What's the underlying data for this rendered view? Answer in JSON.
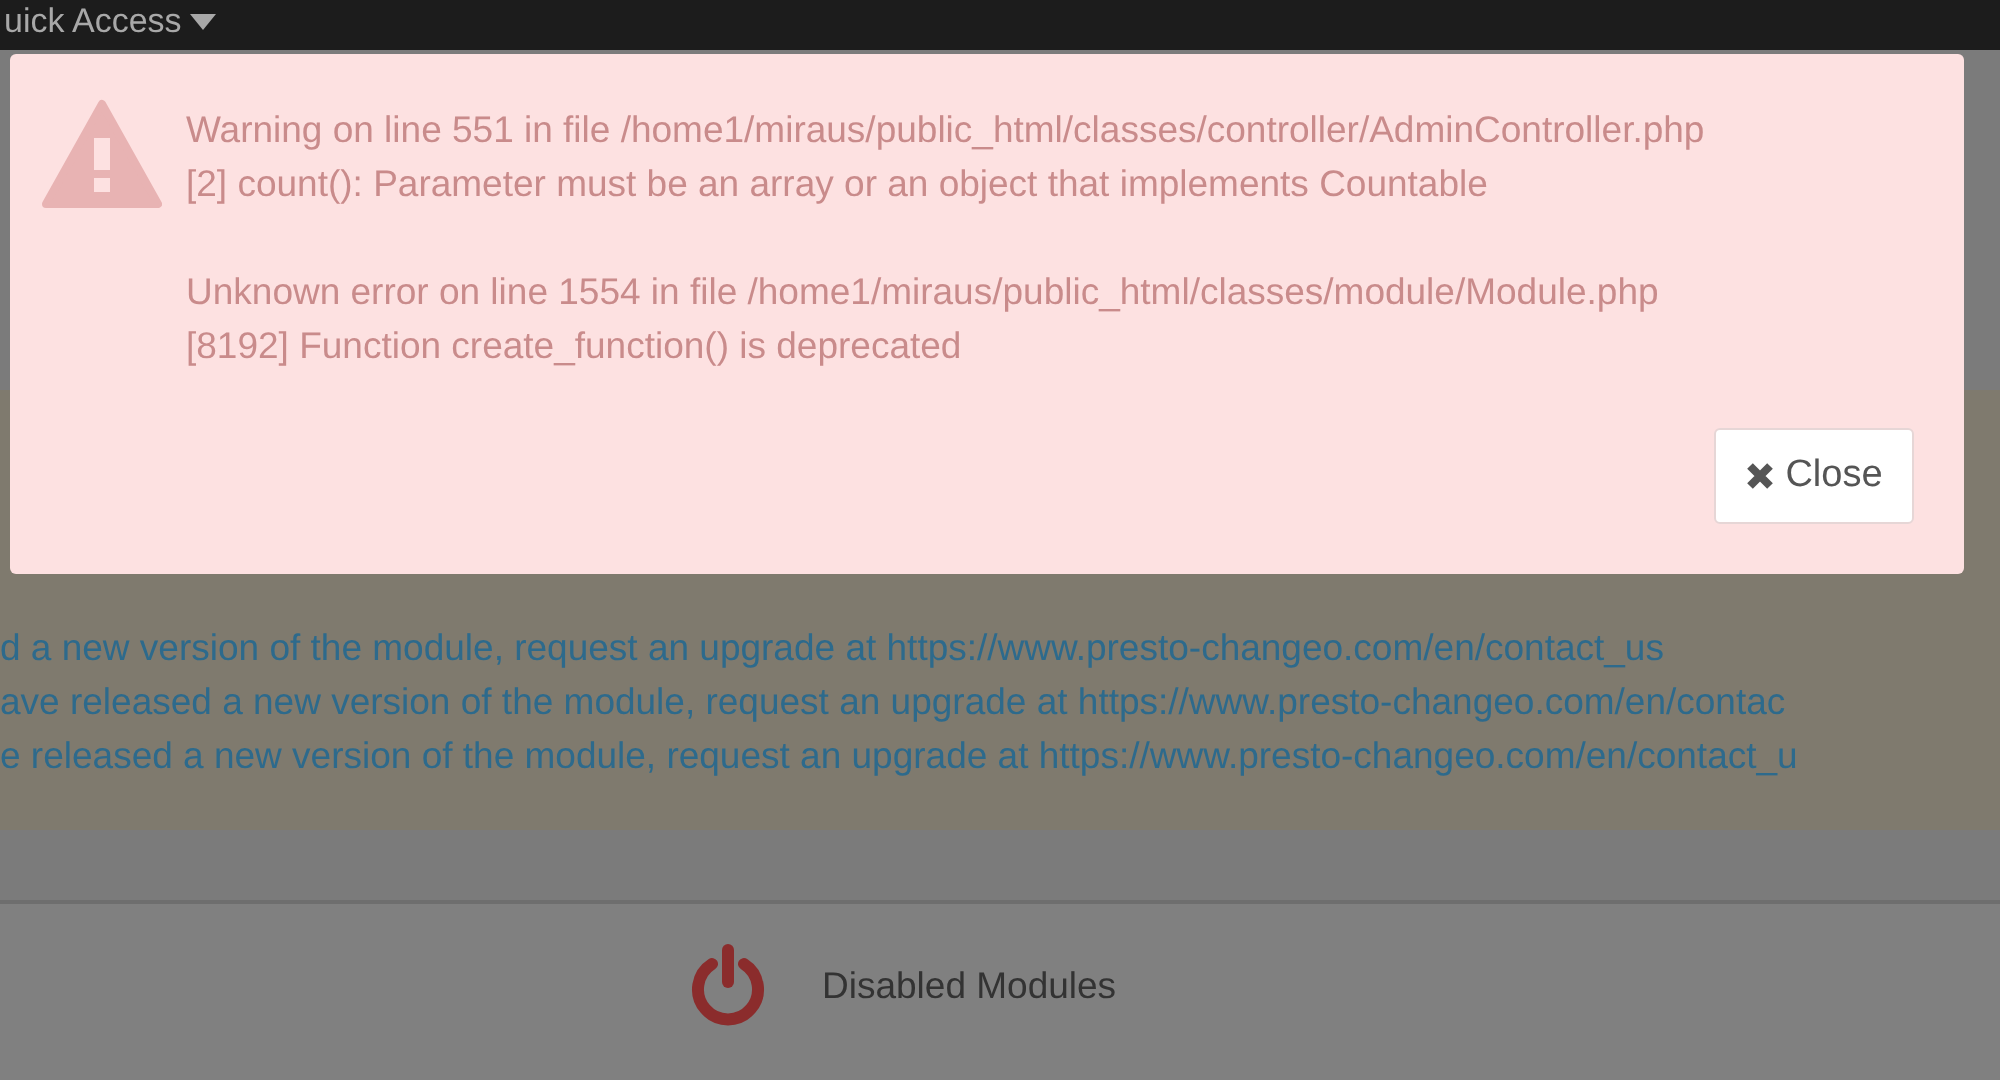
{
  "top_bar": {
    "menu_label": "uick Access"
  },
  "notices": [
    "d a new version of the module, request an upgrade at https://www.presto-changeo.com/en/contact_us",
    "ave released a new version of the module, request an upgrade at https://www.presto-changeo.com/en/contac",
    "e released a new version of the module, request an upgrade at https://www.presto-changeo.com/en/contact_u"
  ],
  "module_section": {
    "label": "Disabled Modules"
  },
  "error_dialog": {
    "messages": [
      {
        "location": "Warning on line 551 in file /home1/miraus/public_html/classes/controller/AdminController.php",
        "detail": "[2] count(): Parameter must be an array or an object that implements Countable"
      },
      {
        "location": "Unknown error on line 1554 in file /home1/miraus/public_html/classes/module/Module.php",
        "detail": "[8192] Function create_function() is deprecated"
      }
    ],
    "close_button": "Close"
  }
}
